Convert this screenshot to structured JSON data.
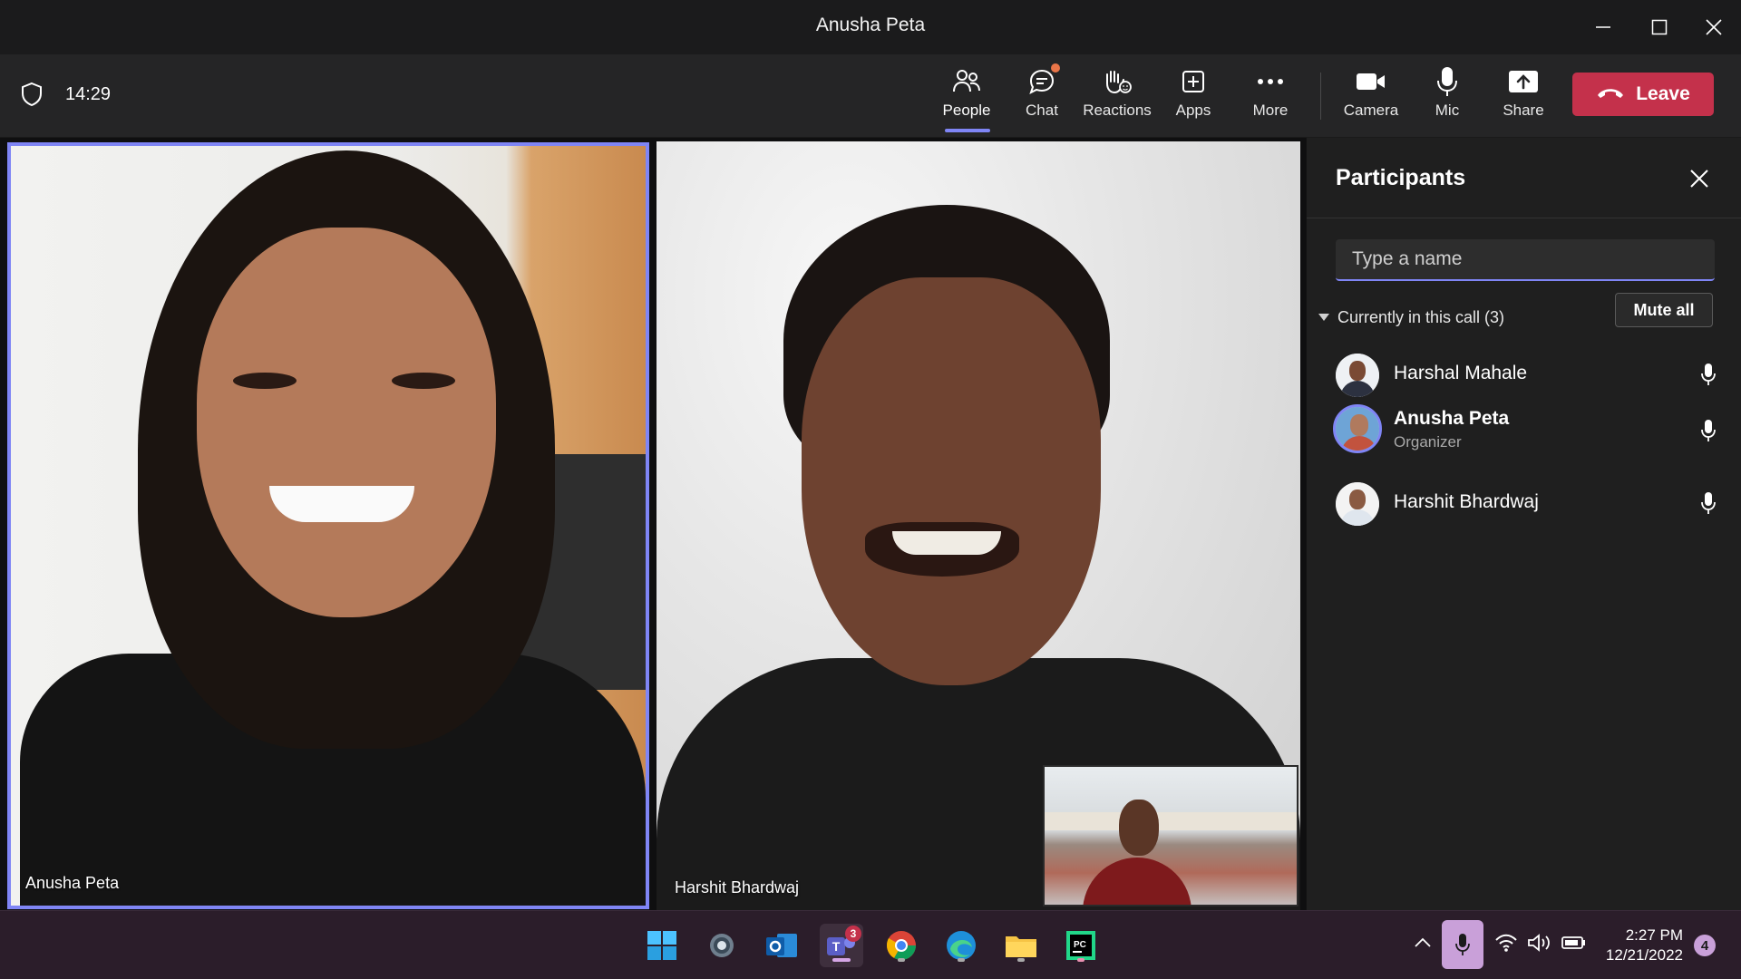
{
  "window": {
    "title": "Anusha Peta"
  },
  "toolbar": {
    "timer": "14:29",
    "items": [
      {
        "label": "People",
        "icon": "people-icon",
        "active": true
      },
      {
        "label": "Chat",
        "icon": "chat-icon"
      },
      {
        "label": "Reactions",
        "icon": "reactions-icon"
      },
      {
        "label": "Apps",
        "icon": "apps-icon"
      },
      {
        "label": "More",
        "icon": "more-icon"
      },
      {
        "label": "Camera",
        "icon": "camera-icon"
      },
      {
        "label": "Mic",
        "icon": "mic-icon"
      },
      {
        "label": "Share",
        "icon": "share-icon"
      }
    ],
    "leave_label": "Leave"
  },
  "stage": {
    "tiles": [
      {
        "name": "Anusha Peta",
        "speaking": true
      },
      {
        "name": "Harshit Bhardwaj"
      }
    ]
  },
  "participants_pane": {
    "title": "Participants",
    "search_placeholder": "Type a name",
    "section_label": "Currently in this call (3)",
    "mute_all_label": "Mute all",
    "people": [
      {
        "name": "Harshal Mahale",
        "role": ""
      },
      {
        "name": "Anusha Peta",
        "role": "Organizer"
      },
      {
        "name": "Harshit Bhardwaj",
        "role": ""
      }
    ]
  },
  "taskbar": {
    "teams_badge": "3",
    "clock_time": "2:27 PM",
    "clock_date": "12/21/2022",
    "notification_count": "4"
  },
  "colors": {
    "accent": "#7f85f5",
    "leave": "#c4314b",
    "chat_dot": "#e97548"
  }
}
